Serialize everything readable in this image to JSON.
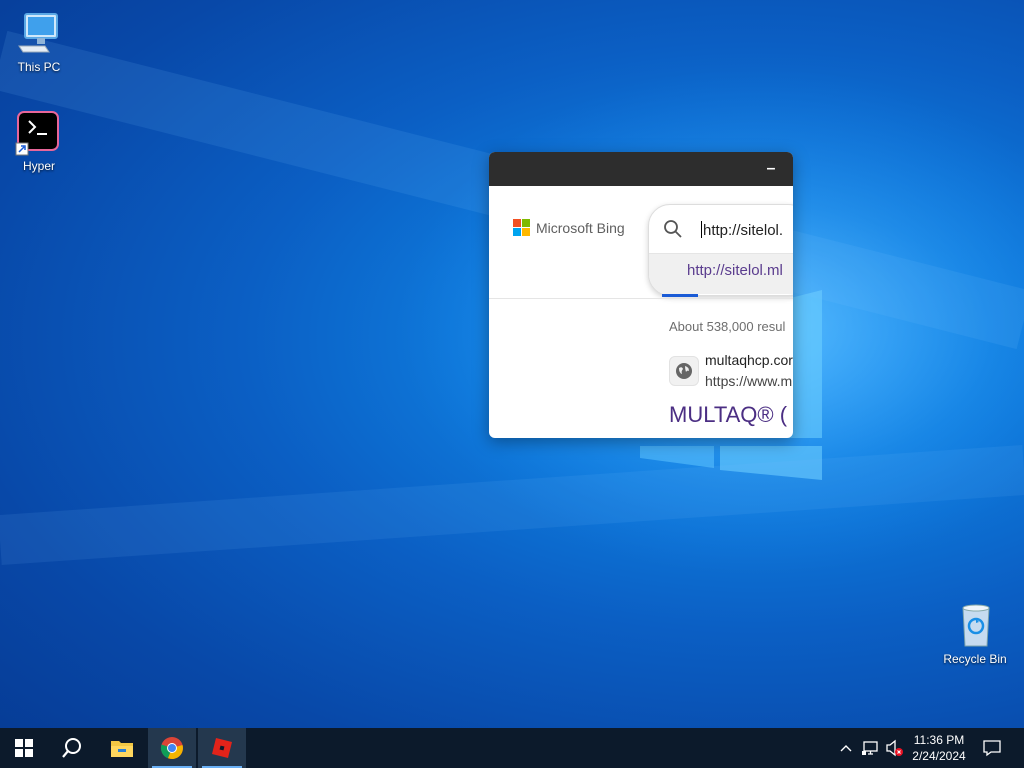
{
  "desktop": {
    "icons": [
      {
        "label": "This PC",
        "icon": "computer-icon"
      },
      {
        "label": "Hyper",
        "icon": "terminal-icon"
      },
      {
        "label": "Recycle Bin",
        "icon": "recycle-bin-icon"
      }
    ]
  },
  "popup": {
    "minimize_label": "–",
    "bing_logo_text": "Microsoft Bing",
    "search_query": "http://sitelol.",
    "suggestion": "http://sitelol.ml",
    "results_count": "About 538,000 resul",
    "result_site_name": "multaqhcp.cor",
    "result_site_url": "https://www.m",
    "result_title": "MULTAQ® (",
    "colors": {
      "titlebar": "#2d2d2d",
      "link": "#4b2e83",
      "accent": "#1a5bd6"
    }
  },
  "taskbar": {
    "apps": [
      {
        "name": "start",
        "icon": "windows-icon"
      },
      {
        "name": "search",
        "icon": "search-icon"
      },
      {
        "name": "file-explorer",
        "icon": "folder-icon"
      },
      {
        "name": "chrome",
        "icon": "chrome-icon"
      },
      {
        "name": "roblox",
        "icon": "roblox-icon"
      }
    ],
    "clock_time": "11:36 PM",
    "clock_date": "2/24/2024"
  }
}
